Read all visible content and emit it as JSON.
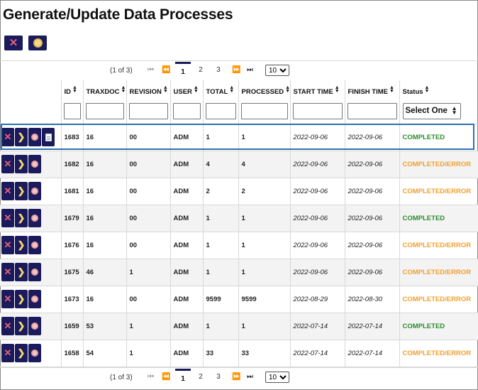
{
  "title": "Generate/Update Data Processes",
  "toolbar": {
    "delete_icon": "close-icon",
    "stop_icon": "stop-icon"
  },
  "pager": {
    "info": "(1 of 3)",
    "first": "⏮",
    "prev": "⏪",
    "pages": [
      "1",
      "2",
      "3"
    ],
    "next": "⏩",
    "last": "⏭",
    "page_size": "10"
  },
  "columns": {
    "id": "ID",
    "traxdoc": "TRAXDOC",
    "revision": "REVISION",
    "user": "USER",
    "total": "TOTAL",
    "processed": "PROCESSED",
    "start_time": "START TIME",
    "finish_time": "FINISH TIME",
    "status": "Status",
    "status_filter": "Select One"
  },
  "rows": [
    {
      "id": "1683",
      "traxdoc": "16",
      "revision": "00",
      "user": "ADM",
      "total": "1",
      "processed": "1",
      "start": "2022-09-06",
      "finish": "2022-09-06",
      "status": "COMPLETED"
    },
    {
      "id": "1682",
      "traxdoc": "16",
      "revision": "00",
      "user": "ADM",
      "total": "4",
      "processed": "4",
      "start": "2022-09-06",
      "finish": "2022-09-06",
      "status": "COMPLETED/ERROR"
    },
    {
      "id": "1681",
      "traxdoc": "16",
      "revision": "00",
      "user": "ADM",
      "total": "2",
      "processed": "2",
      "start": "2022-09-06",
      "finish": "2022-09-06",
      "status": "COMPLETED/ERROR"
    },
    {
      "id": "1679",
      "traxdoc": "16",
      "revision": "00",
      "user": "ADM",
      "total": "1",
      "processed": "1",
      "start": "2022-09-06",
      "finish": "2022-09-06",
      "status": "COMPLETED"
    },
    {
      "id": "1676",
      "traxdoc": "16",
      "revision": "00",
      "user": "ADM",
      "total": "1",
      "processed": "1",
      "start": "2022-09-06",
      "finish": "2022-09-06",
      "status": "COMPLETED/ERROR"
    },
    {
      "id": "1675",
      "traxdoc": "46",
      "revision": "1",
      "user": "ADM",
      "total": "1",
      "processed": "1",
      "start": "2022-09-06",
      "finish": "2022-09-06",
      "status": "COMPLETED/ERROR"
    },
    {
      "id": "1673",
      "traxdoc": "16",
      "revision": "00",
      "user": "ADM",
      "total": "9599",
      "processed": "9599",
      "start": "2022-08-29",
      "finish": "2022-08-30",
      "status": "COMPLETED/ERROR"
    },
    {
      "id": "1659",
      "traxdoc": "53",
      "revision": "1",
      "user": "ADM",
      "total": "1",
      "processed": "1",
      "start": "2022-07-14",
      "finish": "2022-07-14",
      "status": "COMPLETED"
    },
    {
      "id": "1658",
      "traxdoc": "54",
      "revision": "1",
      "user": "ADM",
      "total": "33",
      "processed": "33",
      "start": "2022-07-14",
      "finish": "2022-07-14",
      "status": "COMPLETED/ERROR"
    }
  ],
  "colors": {
    "accent": "#1a1a5c",
    "completed": "#2e8b2e",
    "error": "#f0a030",
    "selection": "#2f6faf"
  }
}
